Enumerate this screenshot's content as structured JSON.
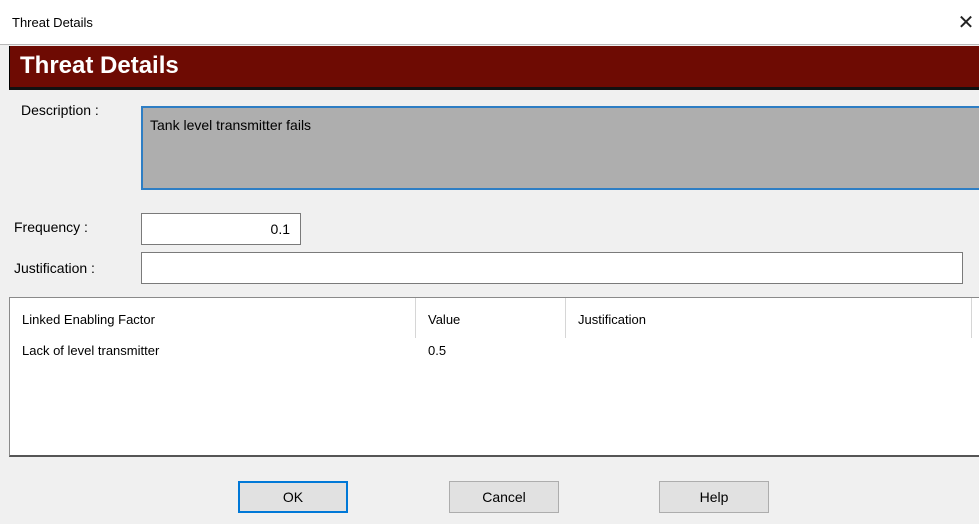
{
  "window": {
    "title": "Threat Details",
    "close_glyph": "✕"
  },
  "banner": {
    "heading": "Threat Details",
    "color": "#6e0b03"
  },
  "form": {
    "description_label": "Description :",
    "description_value": "Tank level transmitter fails",
    "frequency_label": "Frequency :",
    "frequency_value": "0.1",
    "justification_label": "Justification :",
    "justification_value": ""
  },
  "table": {
    "columns": [
      "Linked Enabling Factor",
      "Value",
      "Justification"
    ],
    "rows": [
      {
        "factor": "Lack of level transmitter",
        "value": "0.5",
        "justification": ""
      }
    ]
  },
  "buttons": {
    "ok": "OK",
    "cancel": "Cancel",
    "help": "Help"
  },
  "accent": "#0078d7"
}
